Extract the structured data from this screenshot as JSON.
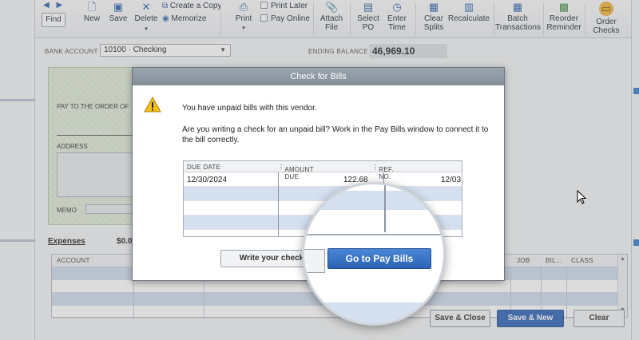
{
  "toolbar": {
    "find": "Find",
    "new": "New",
    "save": "Save",
    "delete": "Delete",
    "create_copy": "Create a Copy",
    "memorize": "Memorize",
    "print": "Print",
    "print_later": "Print Later",
    "pay_online": "Pay Online",
    "attach_file": "Attach File",
    "select_po": "Select PO",
    "enter_time": "Enter Time",
    "clear_splits": "Clear Splits",
    "recalculate": "Recalculate",
    "batch_transactions": "Batch Transactions",
    "reorder_reminder": "Reorder Reminder",
    "order_checks": "Order Checks"
  },
  "form": {
    "bank_account_label": "BANK ACCOUNT",
    "bank_account_value": "10100 · Checking",
    "ending_balance_label": "ENDING BALANCE",
    "ending_balance_value": "46,969.10",
    "pay_to_label": "PAY TO THE ORDER OF",
    "address_label": "ADDRESS",
    "memo_label": "MEMO",
    "expenses_tab": "Expenses",
    "expenses_amount": "$0.0",
    "columns": {
      "account": "ACCOUNT",
      "job": "JOB",
      "bil": "BIL...",
      "class": "CLASS"
    },
    "save_close": "Save & Close",
    "save_new": "Save & New",
    "clear": "Clear"
  },
  "dialog": {
    "title": "Check for Bills",
    "message1": "You have unpaid bills with this vendor.",
    "message2": "Are you writing a check for an unpaid bill? Work in the Pay Bills window to connect it to the bill correctly.",
    "columns": {
      "due_date": "DUE DATE",
      "amount_due": "AMOUNT DUE",
      "ref_no": "REF. NO."
    },
    "bills": [
      {
        "due_date": "12/30/2024",
        "amount_due": "122.68",
        "ref_no": "12/03"
      }
    ],
    "write_check_button": "Write your check",
    "go_to_pay_bills_button": "Go to Pay Bills"
  },
  "colors": {
    "accent_blue": "#2f63b8",
    "row_alt": "#d4e0ef",
    "check_green": "#dbe8d3"
  }
}
